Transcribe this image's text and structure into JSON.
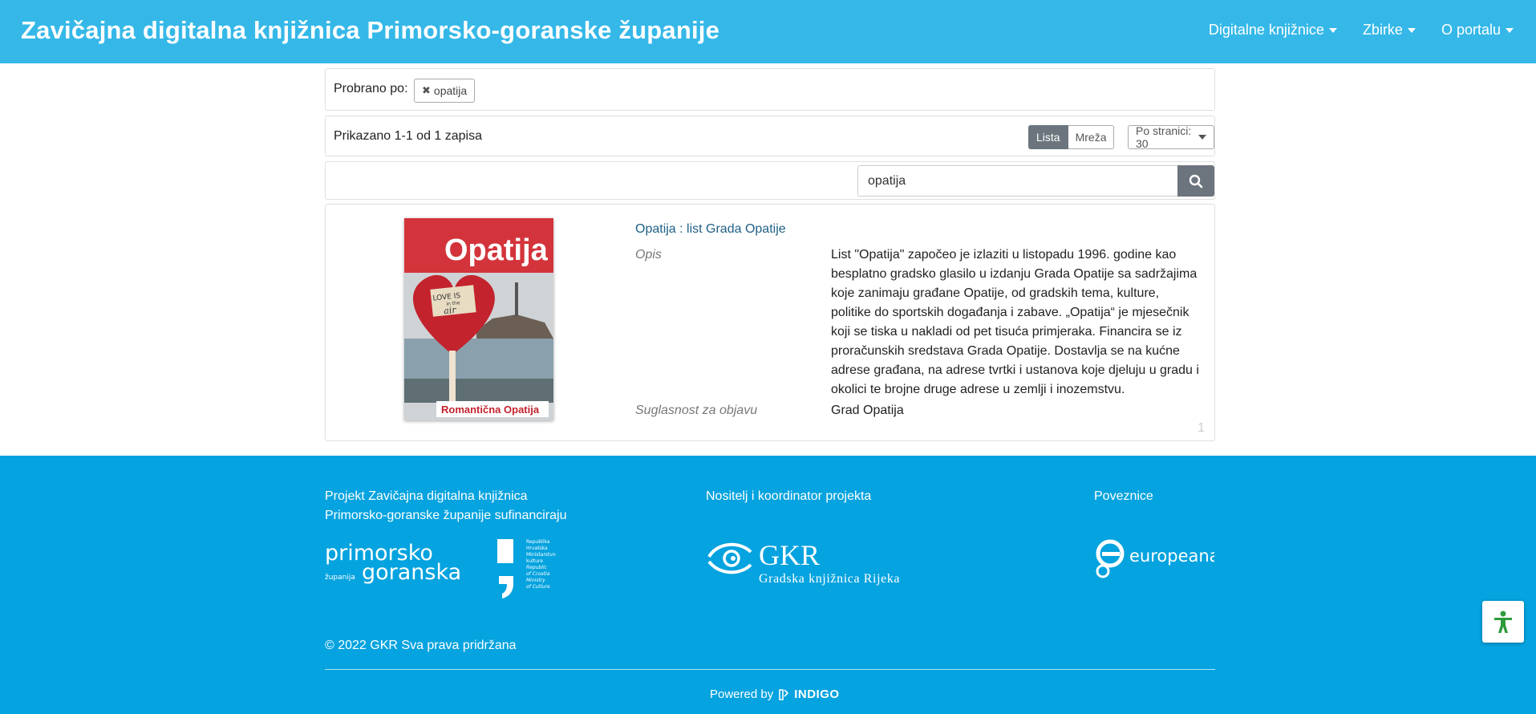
{
  "header": {
    "title": "Zavičajna digitalna knjižnica Primorsko-goranske županije",
    "nav": [
      {
        "label": "Digitalne knjižnice"
      },
      {
        "label": "Zbirke"
      },
      {
        "label": "O portalu"
      }
    ]
  },
  "filters": {
    "label": "Probrano po:",
    "chips": [
      {
        "label": "opatija"
      }
    ]
  },
  "results_bar": {
    "count_text": "Prikazano 1-1 od 1 zapisa",
    "view_list": "Lista",
    "view_grid": "Mreža",
    "per_page": "Po stranici: 30"
  },
  "search": {
    "value": "opatija",
    "icon": "search-icon"
  },
  "result": {
    "title": "Opatija : list Grada Opatije",
    "cover": {
      "header_text": "Opatija",
      "heart_note_line1": "LOVE IS",
      "heart_note_line2": "in the",
      "heart_note_line3": "air",
      "footer_text": "Romantična Opatija"
    },
    "fields": [
      {
        "label": "Opis",
        "lines": [
          "List \"Opatija\" započeo je izlaziti u listopadu 1996. godine kao",
          "besplatno gradsko glasilo u izdanju Grada Opatije sa sadržajima",
          "koje zanimaju građane Opatije, od gradskih tema, kulture,",
          "politike do sportskih događanja i zabave. „Opatija“ je mjesečnik",
          "koji se tiska u nakladi od pet tisuća primjeraka. Financira se iz",
          "proračunskih sredstava Grada Opatije. Dostavlja se na kućne",
          "adrese građana, na adrese tvrtki i ustanova koje djeluju u gradu i",
          "okolici te brojne druge adrese u zemlji i inozemstvu."
        ]
      },
      {
        "label": "Suglasnost za objavu",
        "lines": [
          "Grad Opatija"
        ]
      }
    ],
    "page_number": "1"
  },
  "footer": {
    "col1_line1": "Projekt Zavičajna digitalna knjižnica",
    "col1_line2": "Primorsko-goranske županije sufinanciraju",
    "col2_heading": "Nositelj i koordinator projekta",
    "col3_heading": "Poveznice",
    "pgz_logo": {
      "line1": "primorsko",
      "small": "županija",
      "line2": "goranska"
    },
    "mk_logo": [
      "Republika",
      "Hrvatska",
      "Ministarstvo",
      "kulture",
      "Republic",
      "of Croatia",
      "Ministry",
      "of Culture"
    ],
    "gkr_logo": {
      "main": "GKR",
      "sub": "Gradska knjižnica Rijeka"
    },
    "eu_logo": "europeana",
    "copyright": "© 2022 GKR Sva prava pridržana",
    "powered_by": "Powered by",
    "powered_brand": "INDIGO"
  },
  "colors": {
    "header_bg": "#35b8e8",
    "footer_bg": "#05a3df",
    "link": "#1e5f85",
    "button_dark": "#6c757d",
    "accessibility": "#2e9b3c"
  }
}
